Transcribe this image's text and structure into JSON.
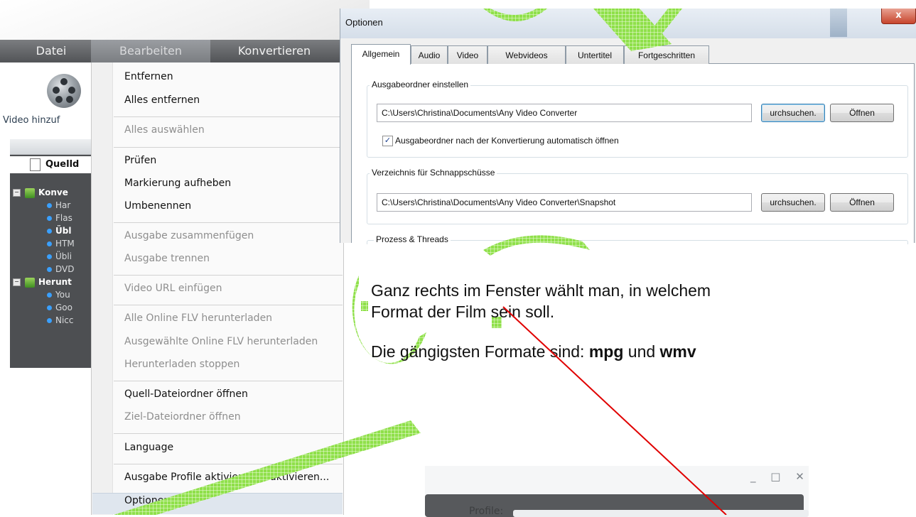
{
  "app": {
    "menubar": [
      "Datei",
      "Bearbeiten",
      "Konvertieren"
    ],
    "toolbar_label": "Video hinzuf",
    "tree": {
      "quelld": "Quelld",
      "konve": "Konve",
      "konve_items": [
        "Har",
        "Flas",
        "Übl",
        "HTM",
        "Übli",
        "DVD"
      ],
      "herunt": "Herunt",
      "herunt_items": [
        "You",
        "Goo",
        "Nicc"
      ]
    }
  },
  "menu": {
    "items": [
      {
        "label": "Entfernen",
        "enabled": true
      },
      {
        "label": "Alles entfernen",
        "enabled": true
      },
      {
        "label": "Alles auswählen",
        "enabled": false
      },
      {
        "label": "Prüfen",
        "enabled": true
      },
      {
        "label": "Markierung aufheben",
        "enabled": true
      },
      {
        "label": "Umbenennen",
        "enabled": true
      },
      {
        "label": "Ausgabe zusammenfügen",
        "enabled": false
      },
      {
        "label": "Ausgabe trennen",
        "enabled": false
      },
      {
        "label": "Video URL einfügen",
        "enabled": false
      },
      {
        "label": "Alle Online FLV herunterladen",
        "enabled": false
      },
      {
        "label": "Ausgewählte Online FLV herunterladen",
        "enabled": false
      },
      {
        "label": "Herunterladen stoppen",
        "enabled": false
      },
      {
        "label": "Quell-Dateiordner öffnen",
        "enabled": true
      },
      {
        "label": "Ziel-Dateiordner öffnen",
        "enabled": false
      },
      {
        "label": "Language",
        "enabled": true
      },
      {
        "label": "Ausgabe Profile aktivieren/deaktivieren...",
        "enabled": true
      },
      {
        "label": "Optionen...",
        "enabled": true,
        "highlighted": true
      }
    ]
  },
  "dialog": {
    "title": "Optionen",
    "close_glyph": "x",
    "tabs": [
      "Allgemein",
      "Audio",
      "Video",
      "Webvideos",
      "Untertitel",
      "Fortgeschritten"
    ],
    "active_tab": "Allgemein",
    "output_group": {
      "title": "Ausgabeordner einstellen",
      "path": "C:\\Users\\Christina\\Documents\\Any Video Converter",
      "browse_label": "urchsuchen.",
      "open_label": "Öffnen",
      "auto_open_checked": true,
      "auto_open_label": "Ausgabeordner nach der Konvertierung automatisch öffnen"
    },
    "snapshot_group": {
      "title": "Verzeichnis für Schnappschüsse",
      "path": "C:\\Users\\Christina\\Documents\\Any Video Converter\\Snapshot",
      "browse_label": "urchsuchen.",
      "open_label": "Öffnen"
    },
    "process_group": {
      "title": "Prozess & Threads"
    }
  },
  "instructions": {
    "line1": "Ganz rechts im Fenster wählt man, in welchem",
    "line2": "Format der Film sein soll.",
    "line3_prefix": "Die gängigsten Formate sind: ",
    "format1": "mpg",
    "line3_mid": " und ",
    "format2": "wmv"
  },
  "mini_window": {
    "controls": "_ □ ✕",
    "profile_label": "Profile:"
  },
  "colors": {
    "watermark_green": "#9be85a",
    "arrow_red": "#e00000",
    "menubar": "#5f6164",
    "tree_bg": "#4d4f52",
    "tree_dot": "#3aa0ff"
  }
}
